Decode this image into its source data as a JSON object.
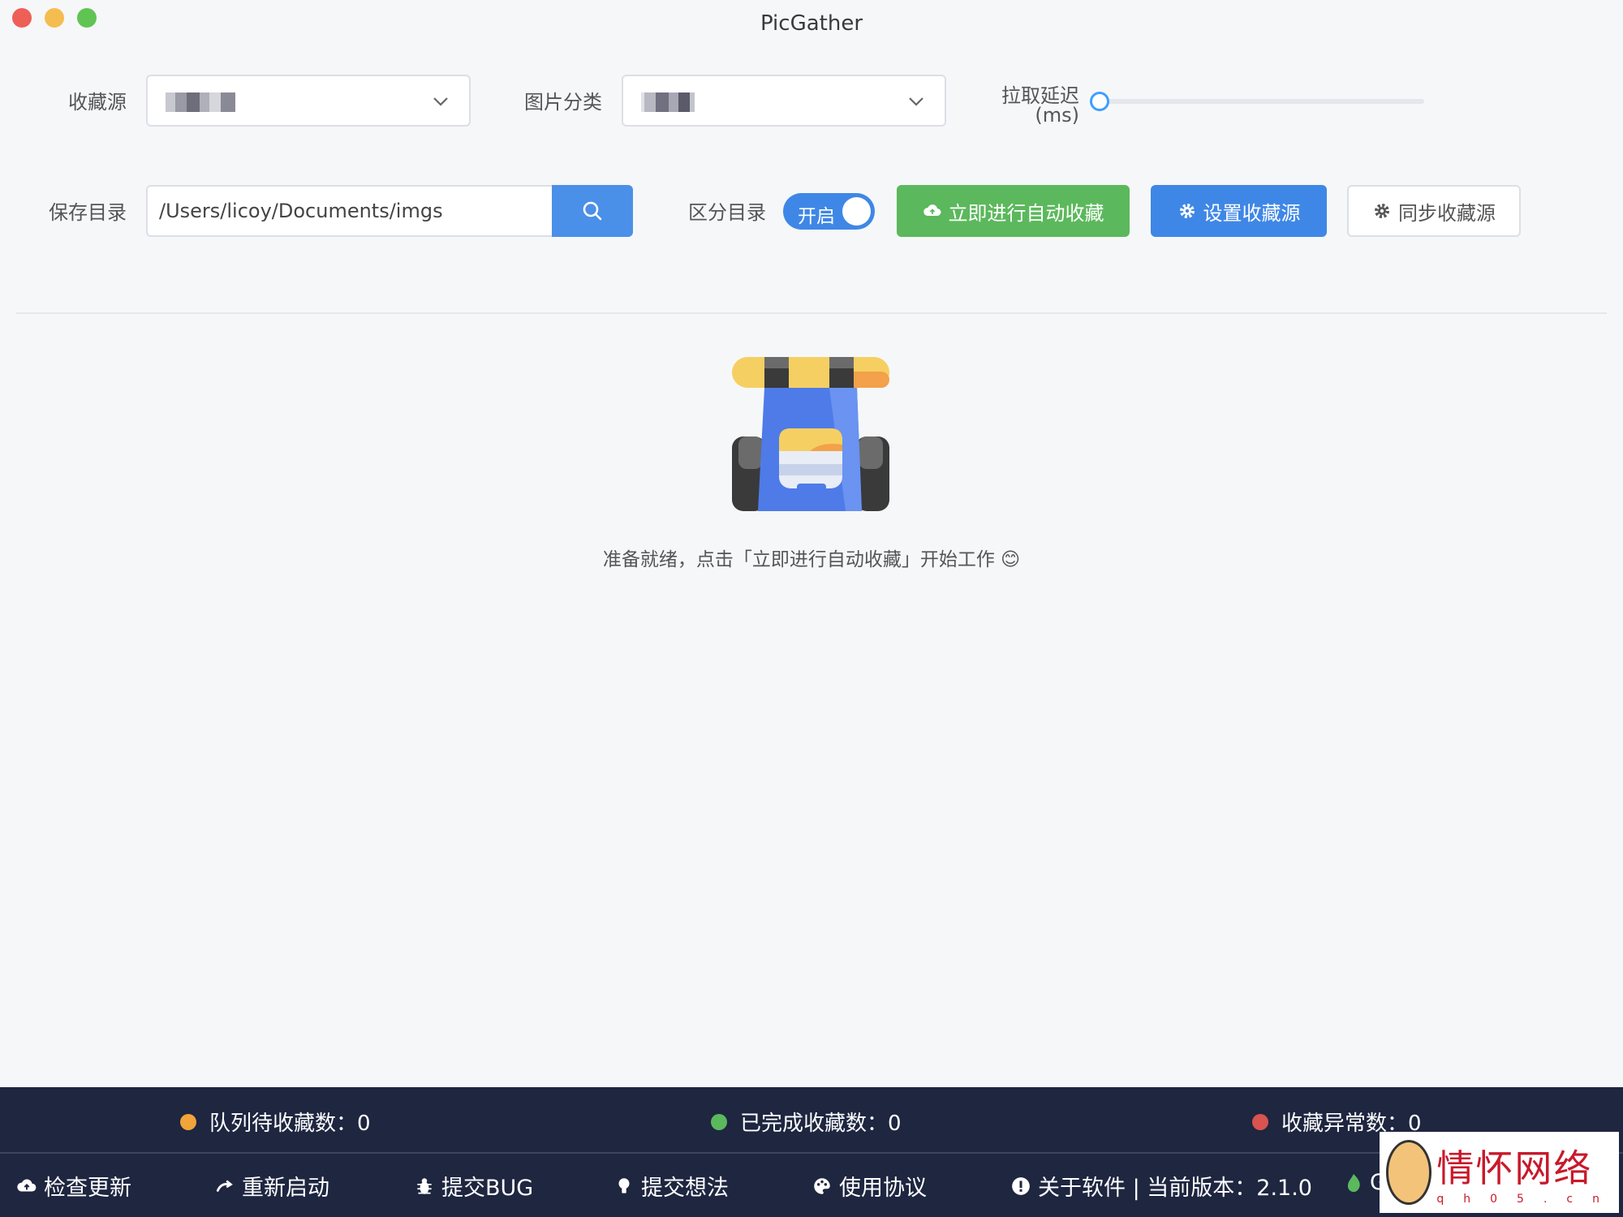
{
  "window": {
    "title": "PicGather"
  },
  "controls": {
    "source_label": "收藏源",
    "category_label": "图片分类",
    "delay_label": "拉取延迟",
    "delay_unit": "(ms)",
    "delay_value": 0,
    "save_dir_label": "保存目录",
    "save_dir_value": "/Users/licoy/Documents/imgs",
    "split_dir_label": "区分目录",
    "split_dir_toggle": "开启",
    "split_dir_on": true
  },
  "buttons": {
    "auto_collect": "立即进行自动收藏",
    "set_source": "设置收藏源",
    "sync_source": "同步收藏源"
  },
  "main": {
    "ready_message": "准备就绪，点击「立即进行自动收藏」开始工作 😊"
  },
  "stats": {
    "queue_label": "队列待收藏数：",
    "queue_value": "0",
    "done_label": "已完成收藏数：",
    "done_value": "0",
    "error_label": "收藏异常数：",
    "error_value": "0",
    "colors": {
      "queue": "#f0a43a",
      "done": "#5cb85c",
      "error": "#d9534f"
    }
  },
  "footer": {
    "check_update": "检查更新",
    "restart": "重新启动",
    "submit_bug": "提交BUG",
    "submit_idea": "提交想法",
    "terms": "使用协议",
    "about": "关于软件 | 当前版本：2.1.0",
    "partial": "G"
  },
  "watermark": {
    "text": "情怀网络",
    "sub": "qh05.cn"
  }
}
